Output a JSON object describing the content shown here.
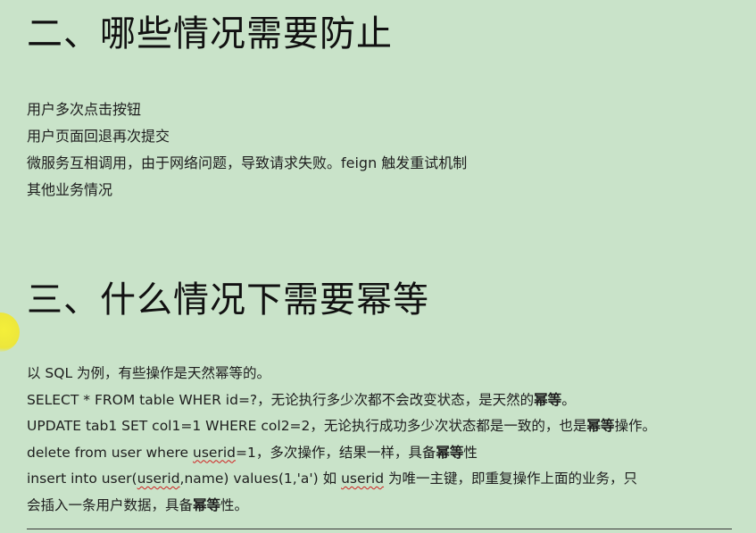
{
  "section2": {
    "title": "二、哪些情况需要防止",
    "items": [
      "用户多次点击按钮",
      "用户页面回退再次提交",
      "微服务互相调用，由于网络问题，导致请求失败。feign 触发重试机制",
      "其他业务情况"
    ]
  },
  "section3": {
    "title": "三、什么情况下需要幂等",
    "line1": "以 SQL 为例，有些操作是天然幂等的。",
    "line2_pre": "SELECT * FROM table WHER id=?，无论执行多少次都不会改变状态，是天然的",
    "line2_bold": "幂等",
    "line2_post": "。",
    "line3_pre": "UPDATE tab1 SET col1=1 WHERE col2=2，无论执行成功多少次状态都是一致的，也是",
    "line3_bold": "幂等",
    "line3_post": "操作。",
    "line4_pre": "delete from user where ",
    "line4_wavy": "userid",
    "line4_mid": "=1，多次操作，结果一样，具备",
    "line4_bold": "幂等",
    "line4_post": "性",
    "line5_pre": "insert into user(",
    "line5_wavy1": "userid",
    "line5_mid": ",name) values(1,'a')  如 ",
    "line5_wavy2": "userid",
    "line5_post": " 为唯一主键，即重复操作上面的业务，只",
    "line6_pre": "会插入一条用户数据，具备",
    "line6_bold": "幂等",
    "line6_post": "性。"
  },
  "colors": {
    "background": "#c9e3c9",
    "cursor_highlight": "#ece63b",
    "spell_underline": "#d02020"
  }
}
